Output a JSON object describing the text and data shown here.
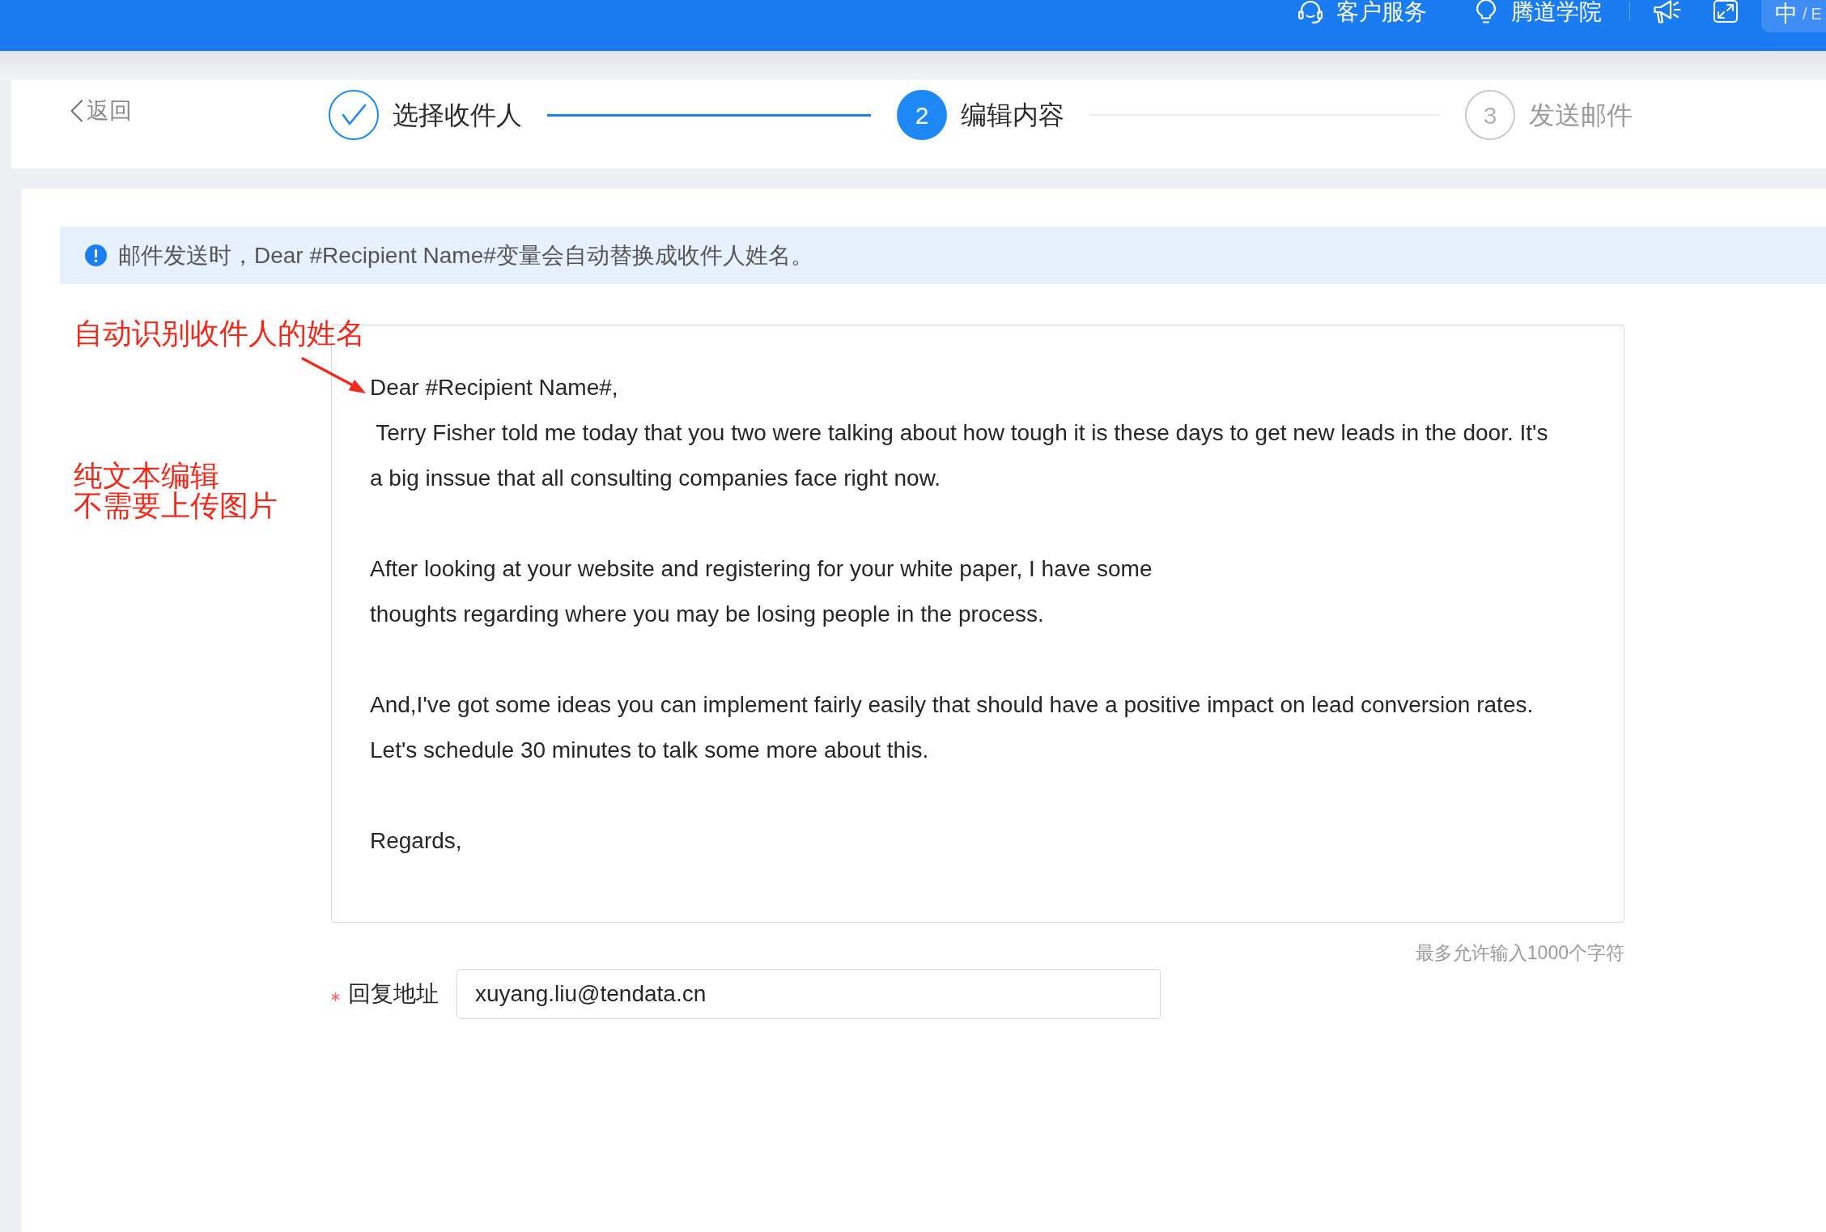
{
  "top_bar": {
    "links": [
      {
        "label": "客户服务"
      },
      {
        "label": "腾道学院"
      }
    ],
    "language_switch": {
      "separator": "/",
      "options": [
        {
          "label": "中",
          "selected": true
        },
        {
          "label": "E",
          "selected": false
        }
      ]
    }
  },
  "stepper": {
    "back_link": "返回",
    "steps": [
      {
        "label": "选择收件人",
        "completed": true,
        "selected": false
      },
      {
        "number": "2",
        "label": "编辑内容",
        "completed": false,
        "selected": true
      },
      {
        "number": "3",
        "label": "发送邮件",
        "completed": false,
        "selected": false
      }
    ]
  },
  "notice": "邮件发送时，Dear #Recipient Name#变量会自动替换成收件人姓名。",
  "annotations": [
    {
      "lines": [
        "自动识别收件人的姓名"
      ],
      "arrow": true
    },
    {
      "lines": [
        "纯文本编辑",
        "不需要上传图片"
      ]
    }
  ],
  "message": {
    "blocks": [
      {
        "lines": [
          "Dear #Recipient Name#,",
          " Terry Fisher told me today that you two were talking about how tough it is these days to get new leads in the door. It's",
          "a big inssue that all consulting companies face right now."
        ]
      },
      {
        "lines": [
          "After looking at your website and registering for your white paper, I have some",
          "thoughts regarding where you may be losing people in the process."
        ]
      },
      {
        "lines": [
          "And,I've got some ideas you can implement fairly easily that should have a positive impact on lead conversion rates.",
          "Let's schedule 30 minutes to talk some more about this."
        ]
      },
      {
        "lines": [
          "Regards,"
        ]
      }
    ],
    "limit_hint": "最多允许输入1000个字符"
  },
  "reply_to": {
    "label": "回复地址",
    "required": true,
    "value": "xuyang.liu@tendata.cn"
  }
}
